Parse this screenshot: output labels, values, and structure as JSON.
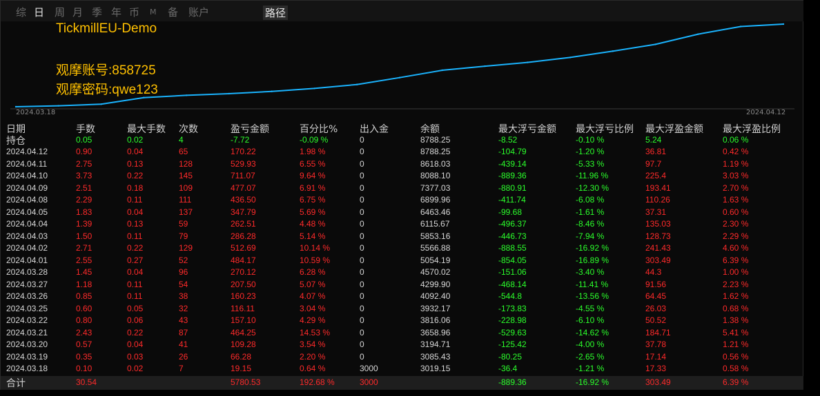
{
  "tabs": [
    {
      "label": "综",
      "active": false,
      "boxed": false
    },
    {
      "label": "日",
      "active": true,
      "boxed": false
    },
    {
      "label": "周",
      "active": false,
      "boxed": false
    },
    {
      "label": "月",
      "active": false,
      "boxed": false
    },
    {
      "label": "季",
      "active": false,
      "boxed": false
    },
    {
      "label": "年",
      "active": false,
      "boxed": false
    },
    {
      "label": "币",
      "active": false,
      "boxed": false
    },
    {
      "label": "M",
      "active": false,
      "boxed": false
    },
    {
      "label": "备",
      "active": false,
      "boxed": false
    },
    {
      "label": "账户",
      "active": false,
      "boxed": false
    },
    {
      "label": "路径",
      "active": false,
      "boxed": true
    }
  ],
  "overlay": {
    "broker": "TickmillEU-Demo",
    "account": "观摩账号:858725",
    "password": "观摩密码:qwe123"
  },
  "chart_data": {
    "type": "line",
    "x_start": "2024.03.18",
    "x_end": "2024.04.12",
    "line_color": "#1ab4ff",
    "x": [
      "2024.03.18",
      "2024.03.19",
      "2024.03.20",
      "2024.03.21",
      "2024.03.22",
      "2024.03.25",
      "2024.03.26",
      "2024.03.27",
      "2024.03.28",
      "2024.04.01",
      "2024.04.02",
      "2024.04.03",
      "2024.04.04",
      "2024.04.05",
      "2024.04.08",
      "2024.04.09",
      "2024.04.10",
      "2024.04.11",
      "2024.04.12"
    ],
    "values": [
      3019.15,
      3085.43,
      3194.71,
      3658.96,
      3816.06,
      3932.17,
      4092.4,
      4299.9,
      4570.02,
      5054.19,
      5566.88,
      5853.16,
      6115.67,
      6463.46,
      6899.96,
      7377.03,
      8088.1,
      8618.03,
      8788.25
    ]
  },
  "columns": [
    "日期",
    "手数",
    "最大手数",
    "次数",
    "盈亏金额",
    "百分比%",
    "出入金",
    "余额",
    "最大浮亏金额",
    "最大浮亏比例",
    "最大浮盈金额",
    "最大浮盈比例"
  ],
  "hold": [
    "持仓",
    "0.05",
    "0.02",
    "4",
    "-7.72",
    "-0.09 %",
    "0",
    "8788.25",
    "-8.52",
    "-0.10 %",
    "5.24",
    "0.06 %"
  ],
  "rows": [
    [
      "2024.04.12",
      "0.90",
      "0.04",
      "65",
      "170.22",
      "1.98 %",
      "0",
      "8788.25",
      "-104.79",
      "-1.20 %",
      "36.81",
      "0.42 %"
    ],
    [
      "2024.04.11",
      "2.75",
      "0.13",
      "128",
      "529.93",
      "6.55 %",
      "0",
      "8618.03",
      "-439.14",
      "-5.33 %",
      "97.7",
      "1.19 %"
    ],
    [
      "2024.04.10",
      "3.73",
      "0.22",
      "145",
      "711.07",
      "9.64 %",
      "0",
      "8088.10",
      "-889.36",
      "-11.96 %",
      "225.4",
      "3.03 %"
    ],
    [
      "2024.04.09",
      "2.51",
      "0.18",
      "109",
      "477.07",
      "6.91 %",
      "0",
      "7377.03",
      "-880.91",
      "-12.30 %",
      "193.41",
      "2.70 %"
    ],
    [
      "2024.04.08",
      "2.29",
      "0.11",
      "111",
      "436.50",
      "6.75 %",
      "0",
      "6899.96",
      "-411.74",
      "-6.08 %",
      "110.26",
      "1.63 %"
    ],
    [
      "2024.04.05",
      "1.83",
      "0.04",
      "137",
      "347.79",
      "5.69 %",
      "0",
      "6463.46",
      "-99.68",
      "-1.61 %",
      "37.31",
      "0.60 %"
    ],
    [
      "2024.04.04",
      "1.39",
      "0.13",
      "59",
      "262.51",
      "4.48 %",
      "0",
      "6115.67",
      "-496.37",
      "-8.46 %",
      "135.03",
      "2.30 %"
    ],
    [
      "2024.04.03",
      "1.50",
      "0.11",
      "79",
      "286.28",
      "5.14 %",
      "0",
      "5853.16",
      "-446.73",
      "-7.94 %",
      "128.73",
      "2.29 %"
    ],
    [
      "2024.04.02",
      "2.71",
      "0.22",
      "129",
      "512.69",
      "10.14 %",
      "0",
      "5566.88",
      "-888.55",
      "-16.92 %",
      "241.43",
      "4.60 %"
    ],
    [
      "2024.04.01",
      "2.55",
      "0.27",
      "52",
      "484.17",
      "10.59 %",
      "0",
      "5054.19",
      "-854.05",
      "-16.89 %",
      "303.49",
      "6.39 %"
    ],
    [
      "2024.03.28",
      "1.45",
      "0.04",
      "96",
      "270.12",
      "6.28 %",
      "0",
      "4570.02",
      "-151.06",
      "-3.40 %",
      "44.3",
      "1.00 %"
    ],
    [
      "2024.03.27",
      "1.18",
      "0.11",
      "54",
      "207.50",
      "5.07 %",
      "0",
      "4299.90",
      "-468.14",
      "-11.41 %",
      "91.56",
      "2.23 %"
    ],
    [
      "2024.03.26",
      "0.85",
      "0.11",
      "38",
      "160.23",
      "4.07 %",
      "0",
      "4092.40",
      "-544.8",
      "-13.56 %",
      "64.45",
      "1.62 %"
    ],
    [
      "2024.03.25",
      "0.60",
      "0.05",
      "32",
      "116.11",
      "3.04 %",
      "0",
      "3932.17",
      "-173.83",
      "-4.55 %",
      "26.03",
      "0.68 %"
    ],
    [
      "2024.03.22",
      "0.80",
      "0.06",
      "43",
      "157.10",
      "4.29 %",
      "0",
      "3816.06",
      "-228.98",
      "-6.10 %",
      "50.52",
      "1.38 %"
    ],
    [
      "2024.03.21",
      "2.43",
      "0.22",
      "87",
      "464.25",
      "14.53 %",
      "0",
      "3658.96",
      "-529.63",
      "-14.62 %",
      "184.71",
      "5.41 %"
    ],
    [
      "2024.03.20",
      "0.57",
      "0.04",
      "41",
      "109.28",
      "3.54 %",
      "0",
      "3194.71",
      "-125.42",
      "-4.00 %",
      "37.78",
      "1.21 %"
    ],
    [
      "2024.03.19",
      "0.35",
      "0.03",
      "26",
      "66.28",
      "2.20 %",
      "0",
      "3085.43",
      "-80.25",
      "-2.65 %",
      "17.14",
      "0.56 %"
    ],
    [
      "2024.03.18",
      "0.10",
      "0.02",
      "7",
      "19.15",
      "0.64 %",
      "3000",
      "3019.15",
      "-36.4",
      "-1.21 %",
      "17.33",
      "0.58 %"
    ]
  ],
  "total": [
    "合计",
    "30.54",
    "",
    "",
    "5780.53",
    "192.68 %",
    "3000",
    "",
    "-889.36",
    "-16.92 %",
    "303.49",
    "6.39 %"
  ]
}
